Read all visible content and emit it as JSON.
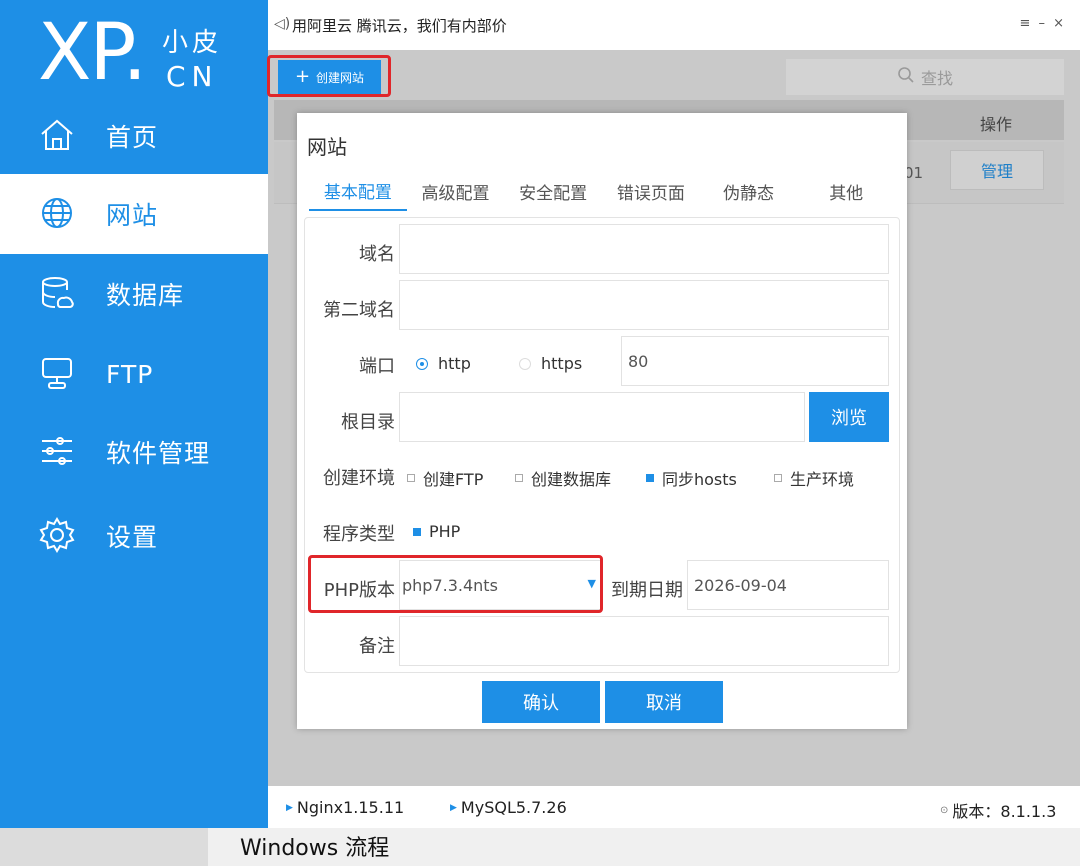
{
  "logo": {
    "main": "XP.",
    "sub": "小皮",
    "domain": "CN"
  },
  "sidebar": {
    "items": [
      {
        "label": "首页",
        "icon": "home-icon",
        "active": false
      },
      {
        "label": "网站",
        "icon": "globe-icon",
        "active": true
      },
      {
        "label": "数据库",
        "icon": "database-icon",
        "active": false
      },
      {
        "label": "FTP",
        "icon": "server-icon",
        "active": false
      },
      {
        "label": "软件管理",
        "icon": "sliders-icon",
        "active": false
      },
      {
        "label": "设置",
        "icon": "gear-icon",
        "active": false
      }
    ]
  },
  "titlebar": {
    "notice": "用阿里云 腾讯云，我们有内部价",
    "controls": "≡ – ×"
  },
  "toolbar": {
    "create_label": "创建网站",
    "search_label": "查找"
  },
  "table": {
    "header_action": "操作",
    "row_tail": "01",
    "manage_label": "管理"
  },
  "dialog": {
    "title": "网站",
    "tabs": [
      "基本配置",
      "高级配置",
      "安全配置",
      "错误页面",
      "伪静态",
      "其他"
    ],
    "active_tab": 0,
    "form": {
      "domain_label": "域名",
      "domain_value": "",
      "second_domain_label": "第二域名",
      "second_domain_value": "",
      "port_label": "端口",
      "protocol_options": [
        "http",
        "https"
      ],
      "protocol_selected": "http",
      "port_value": "80",
      "root_label": "根目录",
      "root_value": "",
      "browse_label": "浏览",
      "env_label": "创建环境",
      "env_options": [
        {
          "label": "创建FTP",
          "checked": false
        },
        {
          "label": "创建数据库",
          "checked": false
        },
        {
          "label": "同步hosts",
          "checked": true
        },
        {
          "label": "生产环境",
          "checked": false
        }
      ],
      "program_type_label": "程序类型",
      "program_type": {
        "label": "PHP",
        "checked": true
      },
      "php_version_label": "PHP版本",
      "php_version_value": "php7.3.4nts",
      "expire_label": "到期日期",
      "expire_value": "2026-09-04",
      "remark_label": "备注",
      "remark_value": ""
    },
    "confirm_label": "确认",
    "cancel_label": "取消"
  },
  "statusbar": {
    "nginx": "Nginx1.15.11",
    "mysql": "MySQL5.7.26",
    "version": "版本：8.1.1.3"
  },
  "background_text": "Windows 流程",
  "colors": {
    "accent": "#1e8fe6",
    "highlight": "#e0262a",
    "overlay": "#c9c9c9"
  }
}
